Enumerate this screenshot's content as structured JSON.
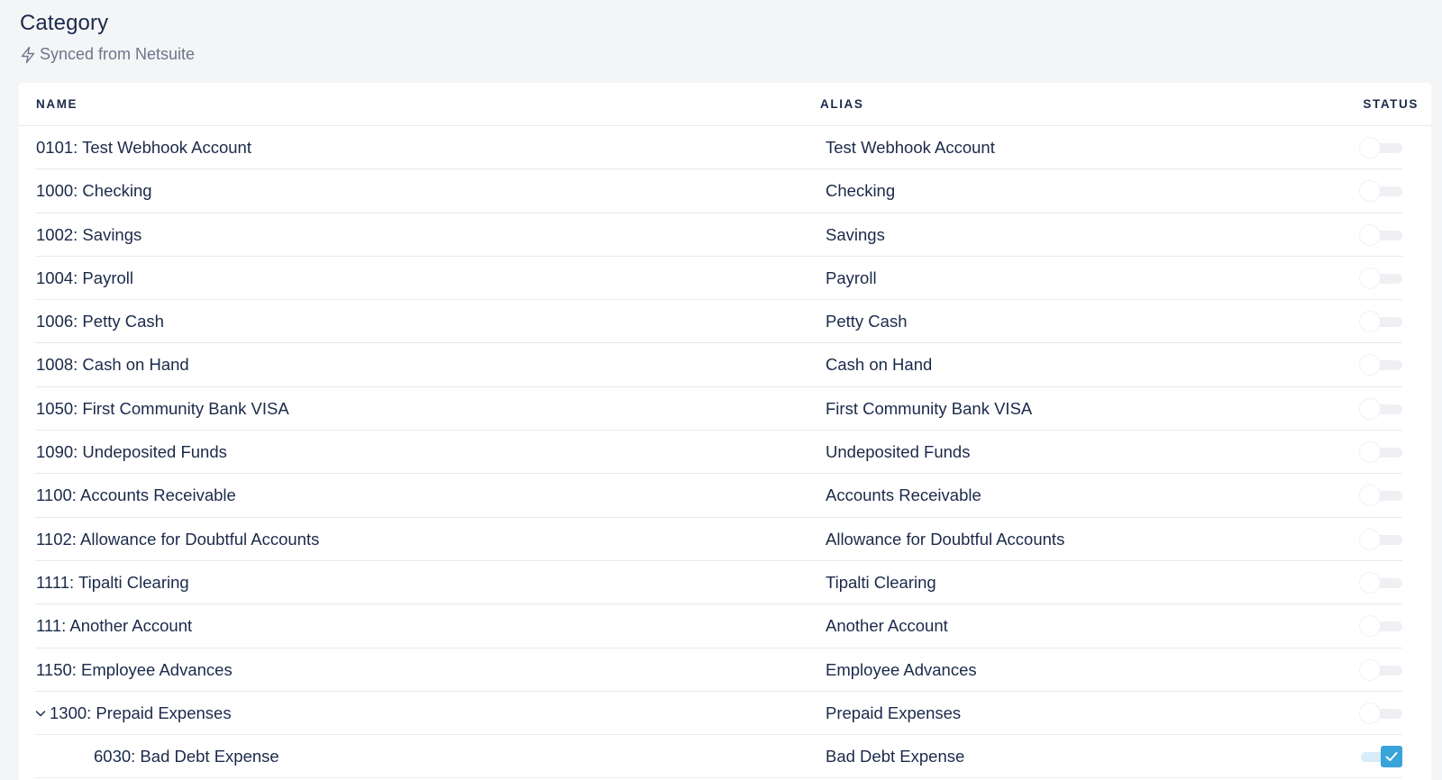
{
  "page": {
    "title": "Category",
    "sync_text": "Synced from Netsuite"
  },
  "table": {
    "headers": {
      "name": "NAME",
      "alias": "ALIAS",
      "status": "STATUS"
    },
    "rows": [
      {
        "name": "0101: Test Webhook Account",
        "alias": "Test Webhook Account",
        "status": false
      },
      {
        "name": "1000: Checking",
        "alias": "Checking",
        "status": false
      },
      {
        "name": "1002: Savings",
        "alias": "Savings",
        "status": false
      },
      {
        "name": "1004: Payroll",
        "alias": "Payroll",
        "status": false
      },
      {
        "name": "1006: Petty Cash",
        "alias": "Petty Cash",
        "status": false
      },
      {
        "name": "1008: Cash on Hand",
        "alias": "Cash on Hand",
        "status": false
      },
      {
        "name": "1050: First Community Bank VISA",
        "alias": "First Community Bank VISA",
        "status": false
      },
      {
        "name": "1090: Undeposited Funds",
        "alias": "Undeposited Funds",
        "status": false
      },
      {
        "name": "1100: Accounts Receivable",
        "alias": "Accounts Receivable",
        "status": false
      },
      {
        "name": "1102: Allowance for Doubtful Accounts",
        "alias": "Allowance for Doubtful Accounts",
        "status": false
      },
      {
        "name": "1111: Tipalti Clearing",
        "alias": "Tipalti Clearing",
        "status": false
      },
      {
        "name": "111: Another Account",
        "alias": "Another Account",
        "status": false
      },
      {
        "name": "1150: Employee Advances",
        "alias": "Employee Advances",
        "status": false
      },
      {
        "name": "1300: Prepaid Expenses",
        "alias": "Prepaid Expenses",
        "status": false
      },
      {
        "name": "6030: Bad Debt Expense",
        "alias": "Bad Debt Expense",
        "status": true
      }
    ]
  },
  "colors": {
    "text": "#1b2a4a",
    "muted": "#6b7688",
    "accent": "#3aa3da",
    "background": "#f4f5f7"
  },
  "icons": {
    "sync": "lightning-icon",
    "expand": "chevron-down-icon",
    "checked": "check-icon"
  }
}
